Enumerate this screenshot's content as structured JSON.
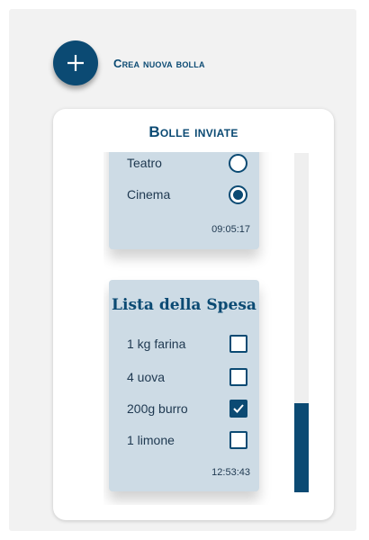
{
  "header": {
    "new_bubble_label": "Crea nuova bolla"
  },
  "sent": {
    "title": "Bolle inviate",
    "bubbles": [
      {
        "options": [
          {
            "label": "Teatro",
            "type": "radio",
            "checked": false
          },
          {
            "label": "Cinema",
            "type": "radio",
            "checked": true
          }
        ],
        "time": "09:05:17"
      },
      {
        "title": "Lista della Spesa",
        "items": [
          {
            "label": "1 kg farina",
            "type": "checkbox",
            "checked": false
          },
          {
            "label": "4 uova",
            "type": "checkbox",
            "checked": false
          },
          {
            "label": "200g burro",
            "type": "checkbox",
            "checked": true
          },
          {
            "label": "1 limone",
            "type": "checkbox",
            "checked": false
          }
        ],
        "time": "12:53:43"
      }
    ]
  },
  "colors": {
    "accent": "#0b4a73",
    "bubble_bg": "#cddbe5",
    "panel_bg": "#f2f2f2"
  },
  "icons": {
    "fab": "plus-icon",
    "check": "check-icon"
  }
}
